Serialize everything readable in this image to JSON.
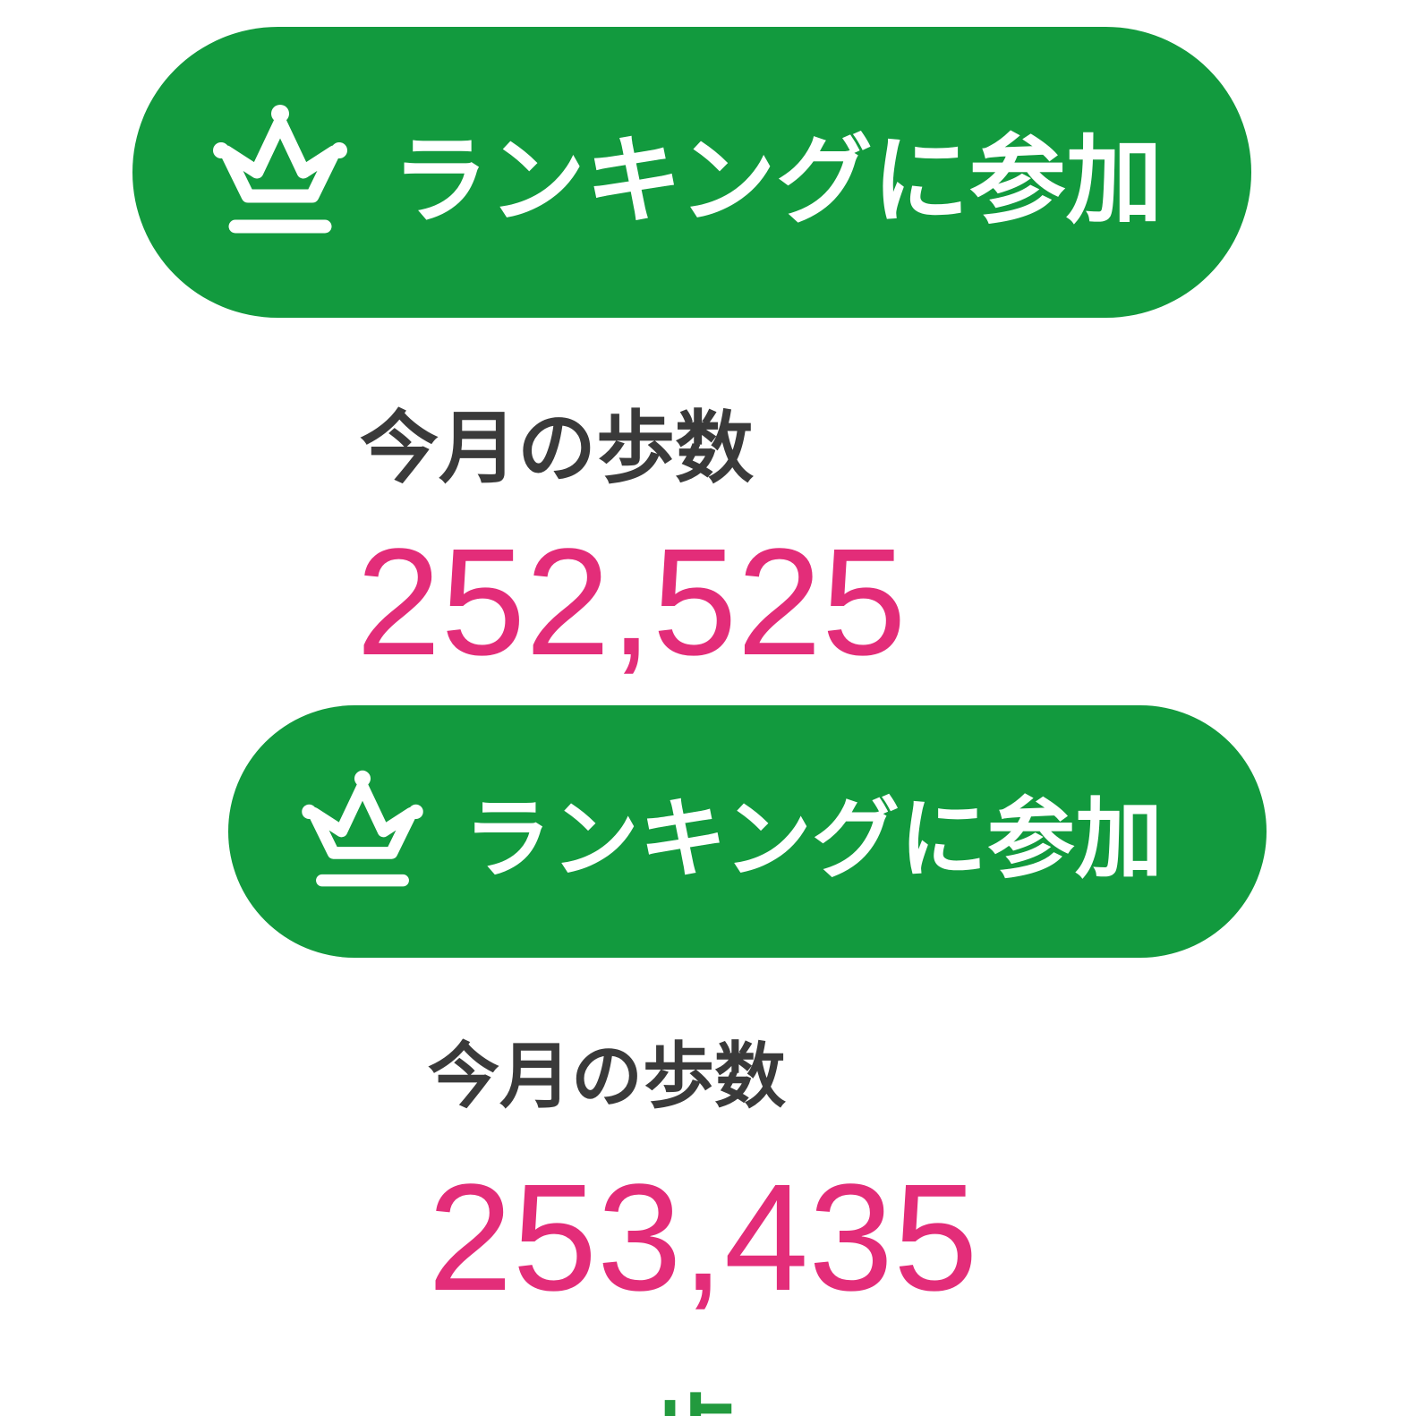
{
  "colors": {
    "button_green": "#129a3e",
    "step_pink": "#e32d79",
    "title_gray": "#3a3a3a",
    "unit_green": "#229a3e"
  },
  "panels": [
    {
      "ranking_button": {
        "icon": "crown-icon",
        "label": "ランキングに参加"
      },
      "steps_title": "今月の歩数",
      "steps_value": "252,525"
    },
    {
      "ranking_button": {
        "icon": "crown-icon",
        "label": "ランキングに参加"
      },
      "steps_title": "今月の歩数",
      "steps_value": "253,435",
      "steps_unit": "歩"
    }
  ]
}
